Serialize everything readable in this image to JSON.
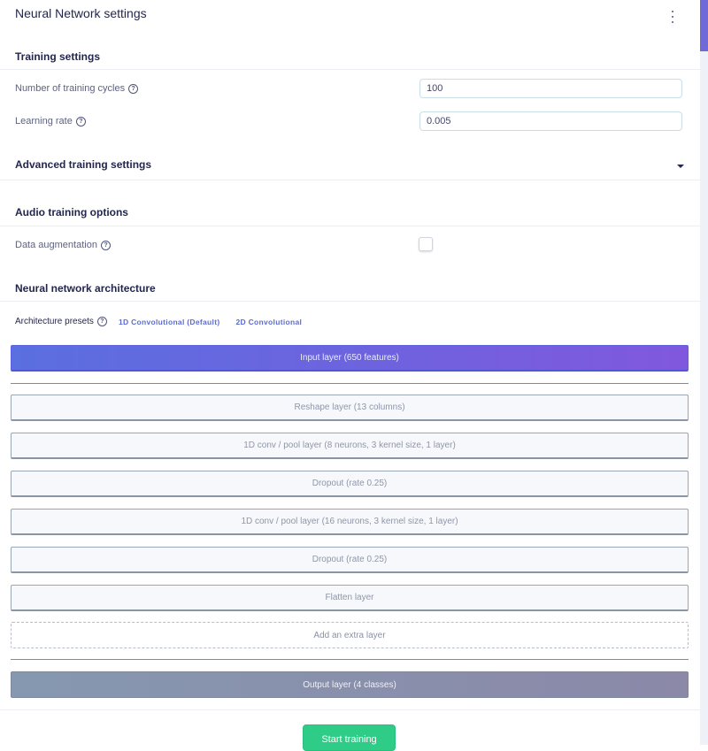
{
  "header": {
    "title": "Neural Network settings",
    "menu_icon": "kebab-menu-icon"
  },
  "training_settings": {
    "heading": "Training settings",
    "fields": [
      {
        "label": "Number of training cycles",
        "value": "100"
      },
      {
        "label": "Learning rate",
        "value": "0.005"
      }
    ]
  },
  "advanced": {
    "heading": "Advanced training settings",
    "toggle_icon": "caret-down-icon"
  },
  "audio": {
    "heading": "Audio training options",
    "data_augmentation": {
      "label": "Data augmentation",
      "checked": false
    }
  },
  "architecture": {
    "heading": "Neural network architecture",
    "presets_label": "Architecture presets",
    "presets": [
      "1D Convolutional (Default)",
      "2D Convolutional"
    ],
    "input_layer": "Input layer (650 features)",
    "layers": [
      "Reshape layer (13 columns)",
      "1D conv / pool layer (8 neurons, 3 kernel size, 1 layer)",
      "Dropout (rate 0.25)",
      "1D conv / pool layer (16 neurons, 3 kernel size, 1 layer)",
      "Dropout (rate 0.25)",
      "Flatten layer"
    ],
    "add_layer": "Add an extra layer",
    "output_layer": "Output layer (4 classes)"
  },
  "actions": {
    "start_training": "Start training"
  },
  "colors": {
    "accent": "#5b6bd6",
    "start_button": "#2ecc87",
    "scrollbar_thumb": "#6f6ad8"
  }
}
